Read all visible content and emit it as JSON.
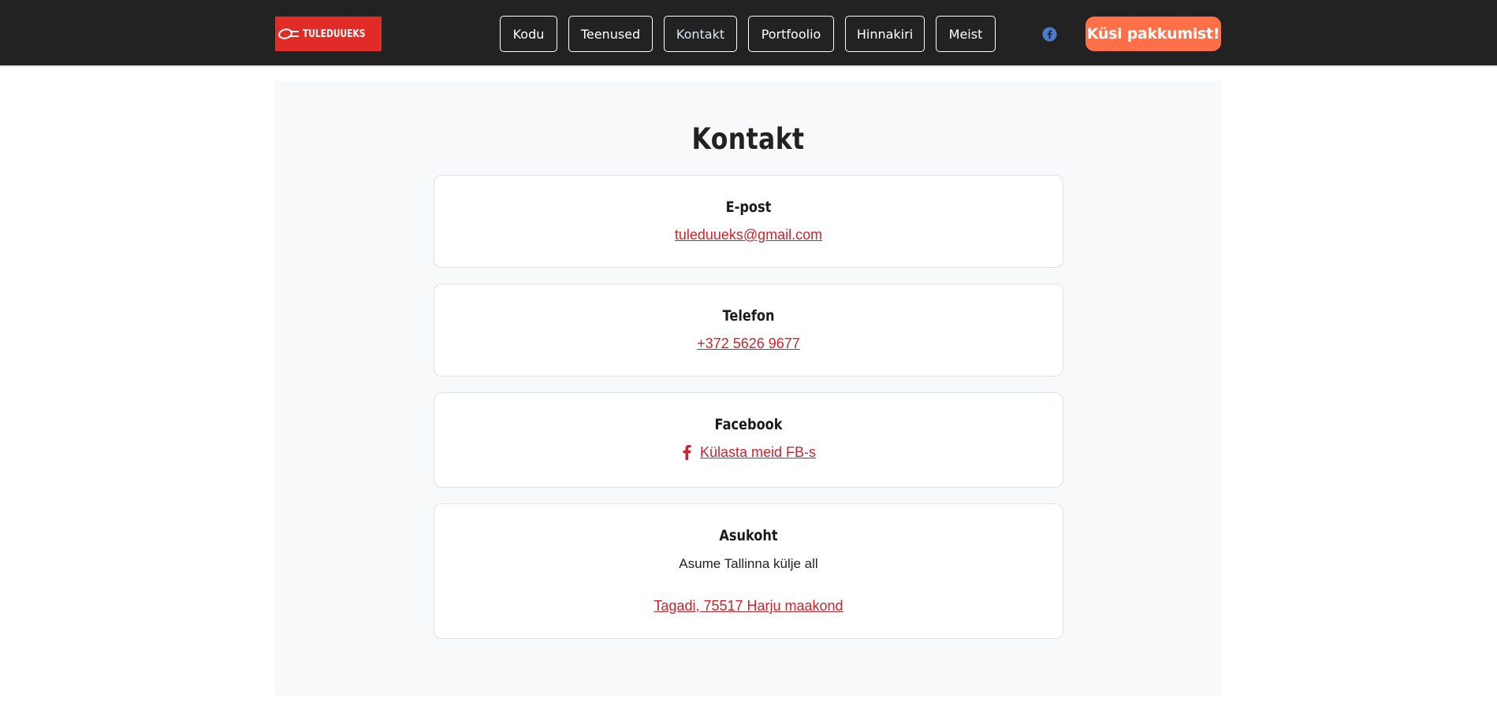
{
  "brand": {
    "logo_text": "TULEDUUEKS",
    "color": "#e02b27"
  },
  "nav": {
    "items": [
      {
        "label": "Kodu",
        "active": false
      },
      {
        "label": "Teenused",
        "active": false
      },
      {
        "label": "Kontakt",
        "active": true
      },
      {
        "label": "Portfoolio",
        "active": false
      },
      {
        "label": "Hinnakiri",
        "active": false
      },
      {
        "label": "Meist",
        "active": false
      }
    ],
    "social_icon": "facebook-icon",
    "cta_label": "Küsi pakkumist!",
    "cta_color": "#ff7048"
  },
  "page": {
    "title": "Kontakt"
  },
  "contact": {
    "email": {
      "title": "E-post",
      "value": "tuleduueks@gmail.com"
    },
    "phone": {
      "title": "Telefon",
      "value": "+372 5626 9677"
    },
    "facebook": {
      "title": "Facebook",
      "icon": "facebook-f-icon",
      "value": "Külasta meid FB-s"
    },
    "location": {
      "title": "Asukoht",
      "text": "Asume Tallinna külje all",
      "address": "Tagadi, 75517 Harju maakond"
    }
  },
  "colors": {
    "header_bg": "#222222",
    "link": "#c9252c",
    "section_bg": "#f8f9fa"
  }
}
